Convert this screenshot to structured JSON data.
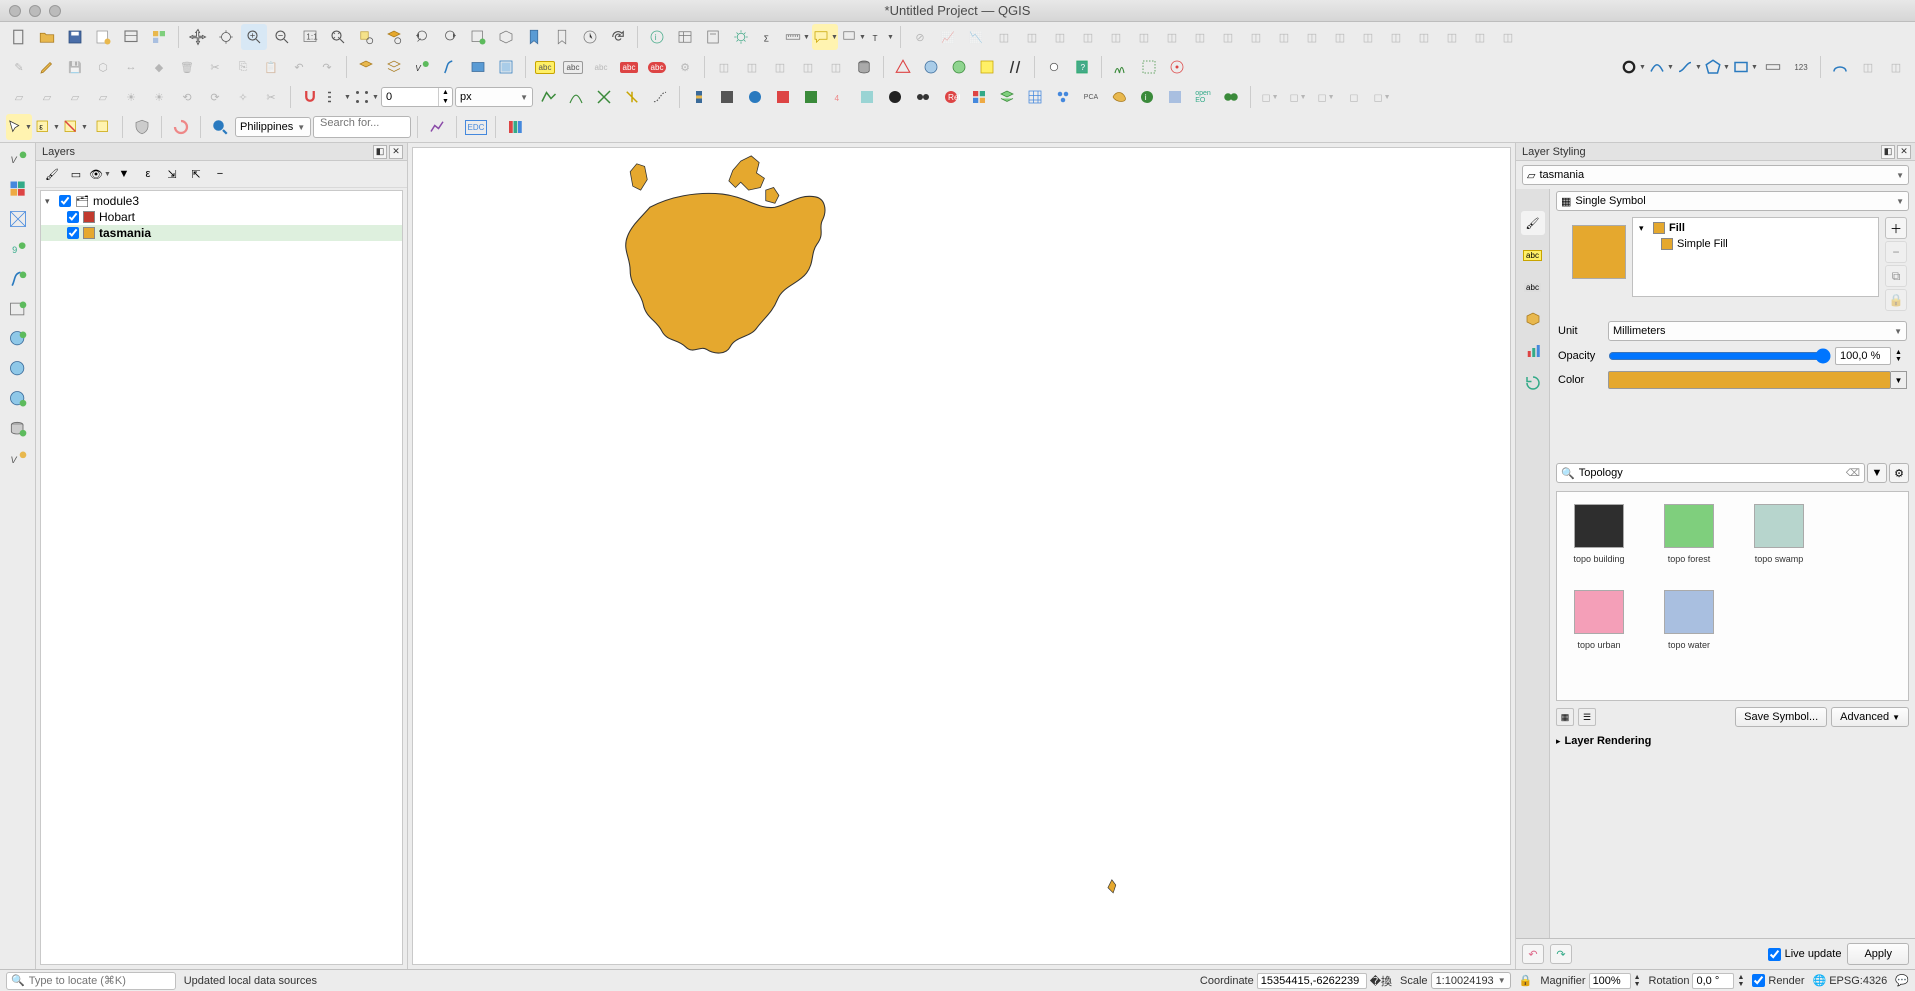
{
  "window": {
    "title": "*Untitled Project — QGIS"
  },
  "toolbar4": {
    "region": "Philippines",
    "search_placeholder": "Search for..."
  },
  "toolbar3": {
    "snap_value": "0",
    "snap_unit": "px"
  },
  "panels": {
    "layers_title": "Layers",
    "styling_title": "Layer Styling"
  },
  "layers": {
    "group": {
      "name": "module3",
      "checked": true
    },
    "items": [
      {
        "name": "Hobart",
        "checked": true,
        "color": "#c23a2e"
      },
      {
        "name": "tasmania",
        "checked": true,
        "color": "#e5a82e",
        "selected": true
      }
    ]
  },
  "styling": {
    "layer": "tasmania",
    "renderer": "Single Symbol",
    "tree": {
      "top": "Fill",
      "child": "Simple Fill"
    },
    "unit_label": "Unit",
    "unit_value": "Millimeters",
    "opacity_label": "Opacity",
    "opacity_value": "100,0 %",
    "color_label": "Color",
    "color_value": "#e5a82e",
    "search_value": "Topology",
    "swatches": [
      {
        "label": "topo building",
        "color": "#2e2e2e"
      },
      {
        "label": "topo forest",
        "color": "#7fcf7d"
      },
      {
        "label": "topo swamp",
        "color": "#b7d5cd"
      },
      {
        "label": "topo urban",
        "color": "#f49fb8"
      },
      {
        "label": "topo water",
        "color": "#a9bfe0"
      }
    ],
    "save_symbol": "Save Symbol...",
    "advanced": "Advanced",
    "layer_rendering": "Layer Rendering",
    "live_update": "Live update",
    "apply": "Apply"
  },
  "status": {
    "locator_placeholder": "Type to locate (⌘K)",
    "message": "Updated local data sources",
    "coord_label": "Coordinate",
    "coord_value": "15354415,-6262239",
    "scale_label": "Scale",
    "scale_value": "1:10024193",
    "magnifier_label": "Magnifier",
    "magnifier_value": "100%",
    "rotation_label": "Rotation",
    "rotation_value": "0,0 °",
    "render_label": "Render",
    "crs": "EPSG:4326"
  }
}
